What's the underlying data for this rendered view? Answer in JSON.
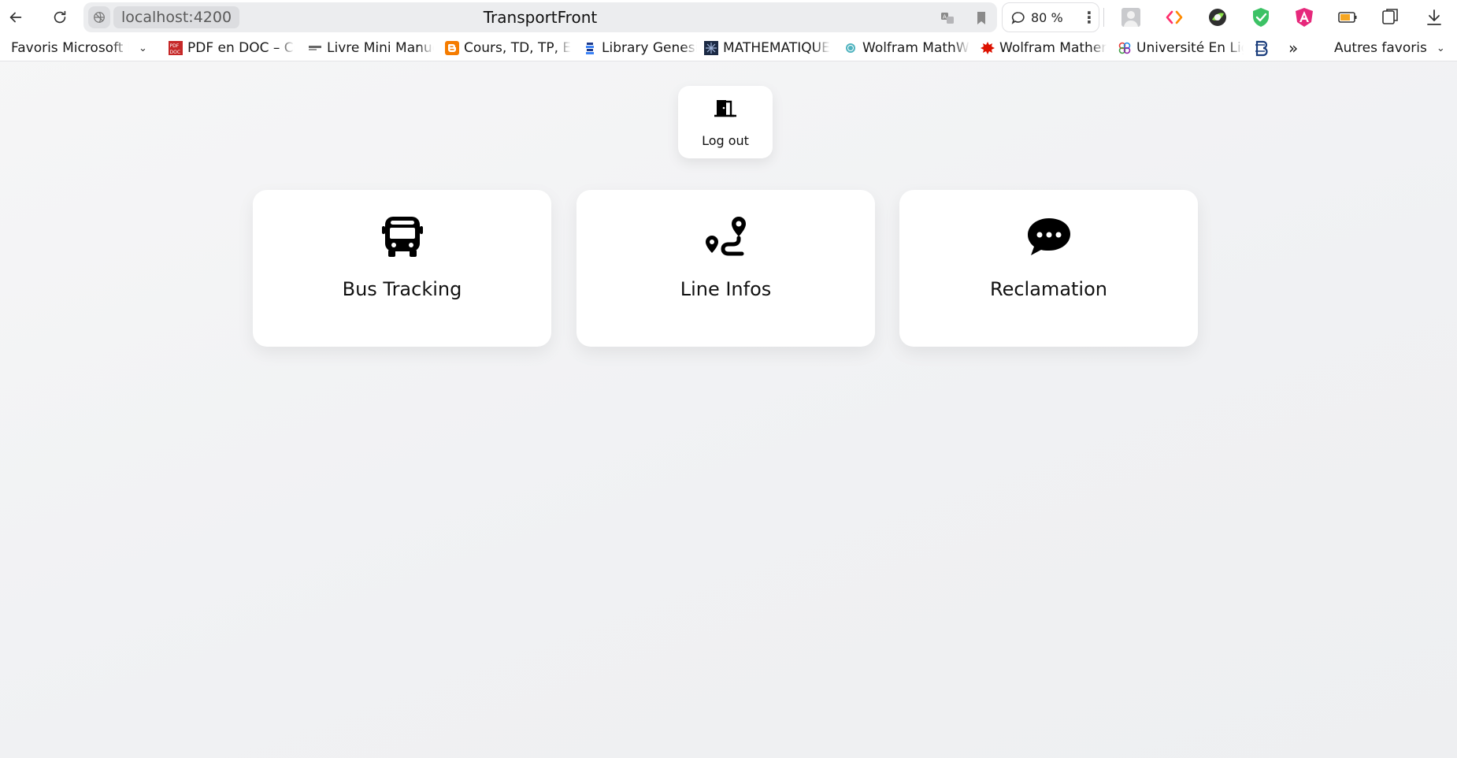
{
  "browser": {
    "url": "localhost:4200",
    "page_title": "TransportFront",
    "zoom": "80 %",
    "menu_dots": "⋮",
    "icons": [
      "back-icon",
      "reload-icon",
      "site-info-icon",
      "translate-icon",
      "bookmark-icon",
      "chat-icon",
      "more-icon"
    ],
    "extensions": [
      "profile-avatar-icon",
      "code-extension-icon",
      "globe-extension-icon",
      "shield-extension-icon",
      "angular-extension-icon",
      "battery-icon",
      "collections-icon",
      "download-icon"
    ]
  },
  "bookmarks": {
    "items": [
      {
        "label": "Favoris Microsoft Edge",
        "icon": "folder-icon"
      },
      {
        "label": "PDF en DOC – Convertisseur",
        "icon": "pdf-doc-icon"
      },
      {
        "label": "Livre Mini Manuel de",
        "icon": "book-icon"
      },
      {
        "label": "Cours, TD, TP, Examens",
        "icon": "blogger-icon"
      },
      {
        "label": "Library Genesis",
        "icon": "library-icon"
      },
      {
        "label": "MATHEMATIQUES",
        "icon": "math-icon"
      },
      {
        "label": "Wolfram MathWorld",
        "icon": "mathworld-icon"
      },
      {
        "label": "Wolfram Mathematica",
        "icon": "wolfram-icon"
      },
      {
        "label": "Université En Ligne",
        "icon": "uel-icon"
      }
    ],
    "overflow": "»",
    "other_folder": "Autres favoris"
  },
  "page": {
    "logout_label": "Log out",
    "cards": [
      {
        "label": "Bus Tracking",
        "icon": "bus-icon"
      },
      {
        "label": "Line Infos",
        "icon": "route-icon"
      },
      {
        "label": "Reclamation",
        "icon": "chat-bubble-icon"
      }
    ]
  }
}
